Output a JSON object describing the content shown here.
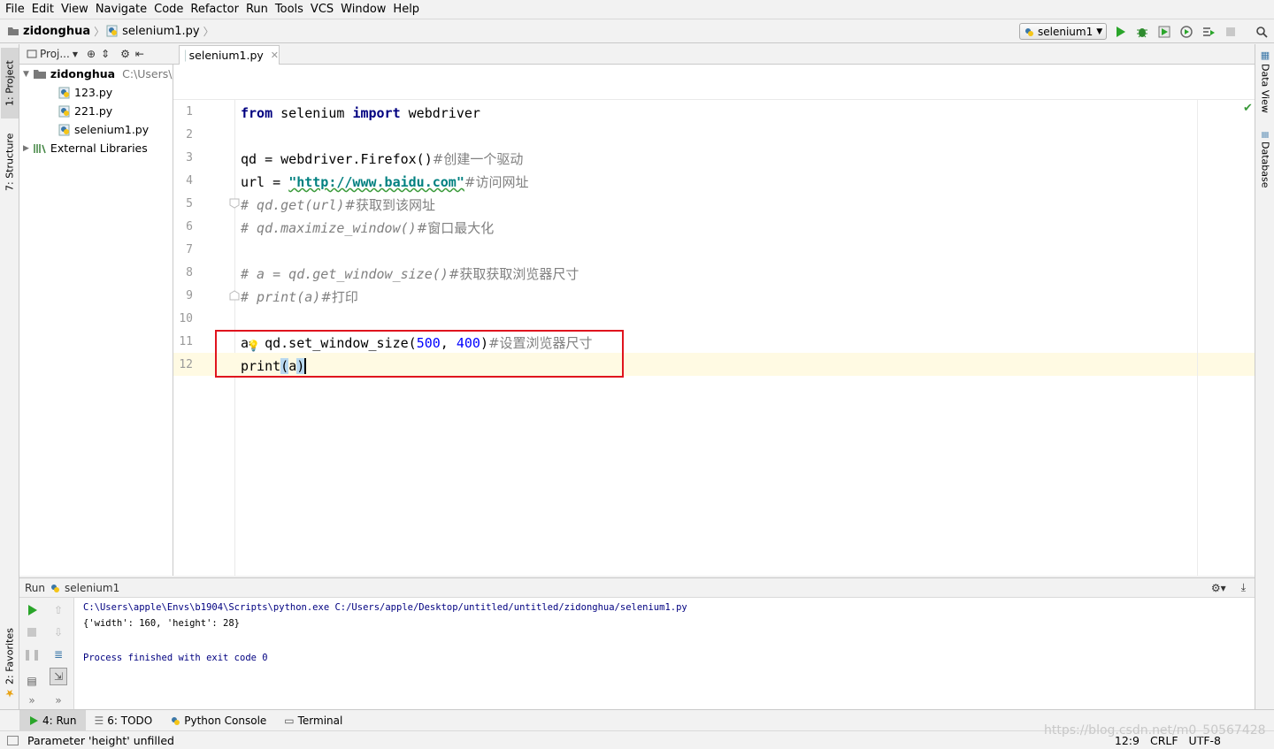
{
  "menu": [
    "File",
    "Edit",
    "View",
    "Navigate",
    "Code",
    "Refactor",
    "Run",
    "Tools",
    "VCS",
    "Window",
    "Help"
  ],
  "nav": {
    "project": "zidonghua",
    "file": "selenium1.py"
  },
  "toolbar": {
    "run_config": "selenium1"
  },
  "left_strip": {
    "project": "1: Project",
    "structure": "7: Structure",
    "favorites": "2: Favorites"
  },
  "right_strip": {
    "data_view": "Data View",
    "database": "Database"
  },
  "project_panel": {
    "title": "Proj...",
    "root": {
      "name": "zidonghua",
      "path": "C:\\Users\\a"
    },
    "files": [
      "123.py",
      "221.py",
      "selenium1.py"
    ],
    "external": "External Libraries"
  },
  "editor": {
    "tab": "selenium1.py",
    "line_numbers": [
      "1",
      "2",
      "3",
      "4",
      "5",
      "6",
      "7",
      "8",
      "9",
      "10",
      "11",
      "12"
    ],
    "line1": {
      "kw1": "from",
      "mod": " selenium ",
      "kw2": "import",
      "rest": " webdriver"
    },
    "line3": {
      "code": "qd = webdriver.Firefox()",
      "comment": "#创建一个驱动"
    },
    "line4": {
      "code": "url = ",
      "str": "\"http://www.baidu.com\"",
      "comment": "#访问网址"
    },
    "line5": {
      "comment": "# qd.get(url)",
      "zh": "#获取到该网址"
    },
    "line6": {
      "comment": "# qd.maximize_window()",
      "zh": "#窗口最大化"
    },
    "line8": {
      "comment": "# a = qd.get_window_size()",
      "zh": "#获取获取浏览器尺寸"
    },
    "line9": {
      "comment": "# print(a)",
      "zh": "#打印"
    },
    "line11": {
      "a": "a",
      "mid": "= qd.set_window_size(",
      "n1": "500",
      "comma": ", ",
      "n2": "400",
      "close": ")",
      "comment": "#设置浏览器尺寸"
    },
    "line12": {
      "fn": "print",
      "open": "(",
      "arg": "a",
      "close": ")"
    }
  },
  "run_panel": {
    "label": "Run",
    "config": "selenium1",
    "output": [
      "C:\\Users\\apple\\Envs\\b1904\\Scripts\\python.exe C:/Users/apple/Desktop/untitled/untitled/zidonghua/selenium1.py",
      "{'width': 160, 'height': 28}",
      "Process finished with exit code 0"
    ]
  },
  "bottom_tabs": {
    "run": "4: Run",
    "todo": "6: TODO",
    "console": "Python Console",
    "terminal": "Terminal"
  },
  "status": {
    "message": "Parameter 'height' unfilled",
    "position": "12:9",
    "line_sep": "CRLF",
    "encoding": "UTF-8",
    "watermark": "https://blog.csdn.net/m0_50567428"
  },
  "colors": {
    "keyword": "#000080",
    "string": "#008080",
    "comment": "#808080",
    "number": "#0000ff",
    "highlight_box": "#e0141e",
    "current_line": "#fffae3"
  }
}
